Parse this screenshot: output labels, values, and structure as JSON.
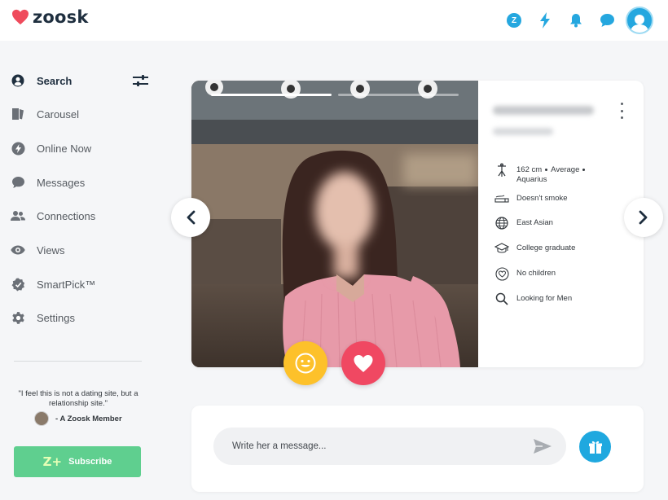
{
  "brand": {
    "name": "zoosk",
    "heart_color": "#ef4b5c"
  },
  "header": {
    "icons": [
      "coins-icon",
      "boost-icon",
      "notifications-icon",
      "messages-icon",
      "profile-avatar"
    ],
    "coin_label": "Z",
    "accent": "#25a7df"
  },
  "sidebar": {
    "items": [
      {
        "label": "Search",
        "icon": "search-user-icon",
        "active": true
      },
      {
        "label": "Carousel",
        "icon": "carousel-icon",
        "active": false
      },
      {
        "label": "Online Now",
        "icon": "lightning-icon",
        "active": false
      },
      {
        "label": "Messages",
        "icon": "chat-bubble-icon",
        "active": false
      },
      {
        "label": "Connections",
        "icon": "people-icon",
        "active": false
      },
      {
        "label": "Views",
        "icon": "eye-icon",
        "active": false
      },
      {
        "label": "SmartPick™",
        "icon": "smartpick-icon",
        "active": false
      },
      {
        "label": "Settings",
        "icon": "gear-icon",
        "active": false
      }
    ],
    "quote": "\"I feel this is not a dating site, but a relationship site.\"",
    "quote_author": "- A Zoosk Member",
    "subscribe_label": "Subscribe",
    "subscribe_icon_text": "Z+",
    "subscribe_color": "#5fcf8f"
  },
  "profile": {
    "photo_count": 2,
    "active_photo": 1,
    "attributes": [
      {
        "icon": "height-icon",
        "parts": [
          "162 cm",
          "Average",
          "Aquarius"
        ]
      },
      {
        "icon": "cigarette-icon",
        "text": "Doesn't smoke"
      },
      {
        "icon": "globe-icon",
        "text": "East Asian"
      },
      {
        "icon": "graduation-cap-icon",
        "text": "College graduate"
      },
      {
        "icon": "heart-outline-icon",
        "text": "No children"
      },
      {
        "icon": "search-icon",
        "text": "Looking for Men"
      }
    ],
    "like_color": "#f04862",
    "smile_color": "#fdc12a"
  },
  "message": {
    "placeholder": "Write her a message...",
    "gift_color": "#1fa8df"
  }
}
